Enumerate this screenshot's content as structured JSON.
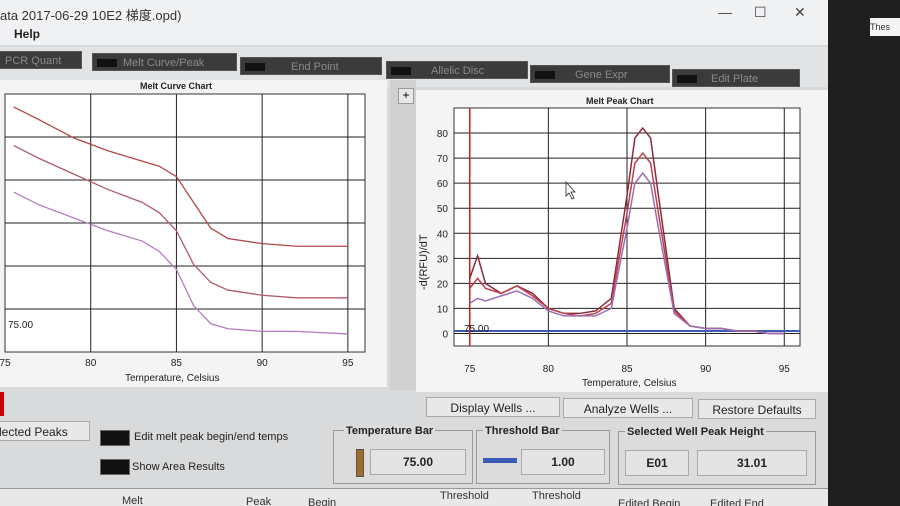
{
  "window": {
    "title": "ata 2017-06-29 10E2 梯度.opd)"
  },
  "menu": {
    "help": "Help"
  },
  "window_controls": {
    "minimize": "—",
    "maximize": "☐",
    "close": "✕"
  },
  "tabs": [
    "PCR Quant",
    "Melt Curve/Peak",
    "End Point",
    "Allelic Disc",
    "Gene Expr",
    "Edit Plate"
  ],
  "melt_curve": {
    "title": "Melt Curve Chart",
    "xlabel": "Temperature, Celsius",
    "temp_marker": "75.00"
  },
  "melt_peak": {
    "title": "Melt Peak Chart",
    "ylabel": "-d(RFU)/dT",
    "xlabel": "Temperature, Celsius",
    "temp_marker": "75.00",
    "plus": "+"
  },
  "buttons": {
    "display_wells": "Display Wells ...",
    "analyze_wells": "Analyze Wells ...",
    "restore_defaults": "Restore Defaults",
    "selected_peaks": "lected Peaks"
  },
  "options": {
    "edit_melt_peak": "Edit melt peak begin/end temps",
    "show_area": "Show Area Results"
  },
  "temperature_bar": {
    "label": "Temperature Bar",
    "value": "75.00",
    "color": "#a06a2a"
  },
  "threshold_bar": {
    "label": "Threshold Bar",
    "value": "1.00",
    "color": "#3b5bb5"
  },
  "selected_well": {
    "label": "Selected Well Peak Height",
    "well": "E01",
    "value": "31.01"
  },
  "grid_headers": [
    "Melt",
    "Peak",
    "Begin",
    "Threshold",
    "Threshold",
    "Edited Begin",
    "Edited End"
  ],
  "taskbar": {
    "label": "Thes"
  },
  "chart_data": [
    {
      "type": "line",
      "title": "Melt Curve Chart",
      "xlabel": "Temperature, Celsius",
      "ylabel": "",
      "xlim": [
        75,
        96
      ],
      "x_ticks": [
        75,
        80,
        85,
        90,
        95
      ],
      "series": [
        {
          "color": "#b04848",
          "x": [
            75.5,
            77,
            79,
            81,
            83,
            84,
            85,
            86,
            87,
            88,
            90,
            92,
            95
          ],
          "y": [
            0.95,
            0.9,
            0.83,
            0.78,
            0.74,
            0.72,
            0.68,
            0.58,
            0.48,
            0.44,
            0.42,
            0.41,
            0.41
          ]
        },
        {
          "color": "#b05a6a",
          "x": [
            75.5,
            77,
            79,
            81,
            83,
            84,
            85,
            86,
            87,
            88,
            90,
            92,
            95
          ],
          "y": [
            0.8,
            0.75,
            0.69,
            0.63,
            0.58,
            0.54,
            0.47,
            0.34,
            0.27,
            0.24,
            0.22,
            0.21,
            0.21
          ]
        },
        {
          "color": "#b57cc0",
          "x": [
            75.5,
            77,
            79,
            81,
            83,
            84,
            85,
            86,
            87,
            88,
            90,
            92,
            95
          ],
          "y": [
            0.62,
            0.57,
            0.52,
            0.47,
            0.43,
            0.39,
            0.32,
            0.18,
            0.11,
            0.09,
            0.08,
            0.08,
            0.07
          ]
        }
      ]
    },
    {
      "type": "line",
      "title": "Melt Peak Chart",
      "xlabel": "Temperature, Celsius",
      "ylabel": "-d(RFU)/dT",
      "xlim": [
        74,
        96
      ],
      "ylim": [
        -5,
        90
      ],
      "x_ticks": [
        75,
        80,
        85,
        90,
        95
      ],
      "y_ticks": [
        0,
        10,
        20,
        30,
        40,
        50,
        60,
        70,
        80
      ],
      "threshold": 1.0,
      "temperature_bar": 75.0,
      "series": [
        {
          "color": "#8a2b3b",
          "x": [
            75,
            75.5,
            76,
            77,
            78,
            79,
            80,
            81,
            82,
            83,
            84,
            85,
            85.5,
            86,
            86.5,
            87,
            88,
            89,
            90,
            91,
            92,
            93,
            94,
            95
          ],
          "y": [
            22,
            31,
            20,
            16,
            19,
            16,
            10,
            8,
            8,
            9,
            14,
            55,
            78,
            82,
            78,
            55,
            10,
            3,
            2,
            2,
            1,
            1,
            0,
            0
          ]
        },
        {
          "color": "#c0404e",
          "x": [
            75,
            75.5,
            76,
            77,
            78,
            79,
            80,
            81,
            82,
            83,
            84,
            85,
            85.5,
            86,
            86.5,
            87,
            88,
            89,
            90,
            91,
            92,
            93,
            94,
            95
          ],
          "y": [
            18,
            22,
            18,
            16,
            19,
            15,
            10,
            8,
            7,
            8,
            12,
            48,
            68,
            72,
            68,
            48,
            9,
            3,
            2,
            2,
            1,
            1,
            0,
            0
          ]
        },
        {
          "color": "#9b6fb5",
          "x": [
            75,
            75.5,
            76,
            77,
            78,
            79,
            80,
            81,
            82,
            83,
            84,
            85,
            85.5,
            86,
            86.5,
            87,
            88,
            89,
            90,
            91,
            92,
            93,
            94,
            95
          ],
          "y": [
            12,
            14,
            13,
            15,
            17,
            14,
            9,
            7,
            7,
            7,
            10,
            42,
            60,
            64,
            60,
            42,
            8,
            3,
            2,
            2,
            1,
            1,
            0,
            0
          ]
        }
      ]
    }
  ]
}
